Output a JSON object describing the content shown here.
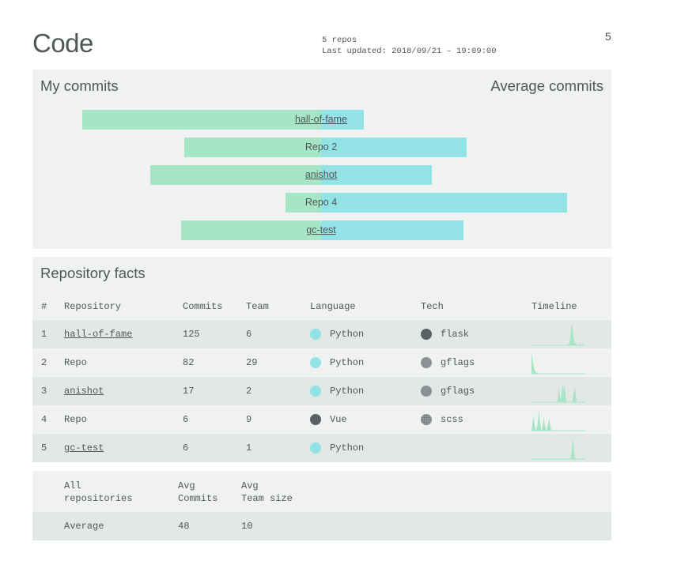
{
  "header": {
    "title": "Code",
    "repo_count": "5 repos",
    "last_updated": "Last updated: 2018/09/21 – 19:09:00",
    "page_number": "5"
  },
  "commits": {
    "my_commits_label": "My commits",
    "average_commits_label": "Average commits",
    "bars": [
      {
        "label": "hall-of-fame",
        "link": true,
        "my_extent": 302,
        "avg_extent": 54
      },
      {
        "label": "Repo 2",
        "link": false,
        "my_extent": 173,
        "avg_extent": 184
      },
      {
        "label": "anishot",
        "link": true,
        "my_extent": 216,
        "avg_extent": 140
      },
      {
        "label": "Repo 4",
        "link": false,
        "my_extent": 45,
        "avg_extent": 311
      },
      {
        "label": "gc-test",
        "link": true,
        "my_extent": 177,
        "avg_extent": 180
      }
    ],
    "colors": {
      "my": "#a6e6c6",
      "average": "#93e2e6"
    }
  },
  "facts": {
    "heading": "Repository facts",
    "columns": [
      "#",
      "Repository",
      "Commits",
      "Team",
      "Language",
      "Tech",
      "Timeline"
    ],
    "rows": [
      {
        "num": "1",
        "repo": "hall-of-fame",
        "link": true,
        "commits": "125",
        "team": "6",
        "language": "Python",
        "lang_color": "#93e2e6",
        "tech": "flask",
        "tech_color": "#5a6163",
        "timeline": [
          0,
          0,
          0,
          0,
          0,
          0,
          0,
          0,
          0,
          0,
          0,
          0,
          0,
          0,
          0,
          0,
          0,
          0,
          0,
          0,
          0,
          0,
          0,
          0,
          0,
          0,
          0,
          0,
          0,
          0,
          0,
          0,
          0,
          0,
          0,
          0,
          0,
          0,
          0,
          0,
          0.1,
          0.3,
          0.8,
          1,
          0.6,
          0.2,
          0.1,
          0.05,
          0,
          0,
          0,
          0.1,
          0.05,
          0,
          0.1,
          0,
          0,
          0
        ]
      },
      {
        "num": "2",
        "repo": "Repo",
        "link": false,
        "commits": "82",
        "team": "29",
        "language": "Python",
        "lang_color": "#93e2e6",
        "tech": "gflags",
        "tech_color": "#8b9294",
        "timeline": [
          0.9,
          0.7,
          0.4,
          0.2,
          0.1,
          0.05,
          0.05,
          0,
          0,
          0,
          0,
          0,
          0,
          0,
          0,
          0,
          0,
          0,
          0,
          0,
          0,
          0,
          0,
          0,
          0,
          0,
          0,
          0,
          0,
          0,
          0,
          0,
          0,
          0,
          0,
          0,
          0,
          0,
          0,
          0,
          0,
          0,
          0,
          0,
          0,
          0,
          0,
          0,
          0,
          0,
          0,
          0,
          0,
          0,
          0,
          0,
          0,
          0
        ]
      },
      {
        "num": "3",
        "repo": "anishot",
        "link": true,
        "commits": "17",
        "team": "2",
        "language": "Python",
        "lang_color": "#93e2e6",
        "tech": "gflags",
        "tech_color": "#8b9294",
        "timeline": [
          0,
          0,
          0,
          0,
          0,
          0,
          0,
          0,
          0,
          0,
          0,
          0,
          0,
          0,
          0,
          0,
          0,
          0,
          0,
          0,
          0,
          0,
          0,
          0,
          0,
          0,
          0,
          0,
          0.2,
          0.6,
          0.3,
          0.1,
          0.4,
          0.8,
          0.5,
          0.9,
          0.3,
          0.1,
          0,
          0,
          0,
          0,
          0,
          0,
          0.2,
          0.5,
          0.7,
          0.3,
          0,
          0,
          0,
          0,
          0,
          0,
          0,
          0,
          0,
          0
        ]
      },
      {
        "num": "4",
        "repo": "Repo",
        "link": false,
        "commits": "6",
        "team": "9",
        "language": "Vue",
        "lang_color": "#5a6163",
        "tech": "scss",
        "tech_color": "#9aa0a2",
        "timeline": [
          0,
          0.3,
          0.7,
          0.4,
          0.1,
          0,
          0.2,
          0.5,
          0.9,
          0.4,
          0.1,
          0,
          0.3,
          0.6,
          0.3,
          0.1,
          0,
          0.2,
          0.4,
          0.5,
          0.2,
          0,
          0,
          0,
          0,
          0,
          0,
          0,
          0,
          0,
          0,
          0,
          0,
          0,
          0,
          0,
          0,
          0,
          0,
          0,
          0,
          0,
          0,
          0,
          0,
          0,
          0,
          0,
          0,
          0,
          0,
          0,
          0,
          0,
          0,
          0,
          0,
          0
        ]
      },
      {
        "num": "5",
        "repo": "gc-test",
        "link": true,
        "commits": "6",
        "team": "1",
        "language": "Python",
        "lang_color": "#93e2e6",
        "tech": "",
        "tech_color": "",
        "timeline": [
          0.02,
          0.02,
          0.02,
          0.02,
          0.02,
          0.02,
          0.02,
          0.02,
          0.02,
          0.02,
          0.02,
          0.02,
          0.02,
          0.02,
          0.02,
          0.02,
          0.02,
          0.02,
          0.02,
          0.02,
          0.02,
          0.02,
          0.02,
          0.02,
          0.02,
          0.02,
          0.02,
          0.02,
          0.02,
          0.02,
          0.02,
          0.02,
          0.02,
          0.02,
          0.02,
          0.02,
          0.02,
          0.02,
          0.02,
          0.02,
          0.02,
          0.02,
          0.1,
          0.5,
          1,
          0.3,
          0.05,
          0.02,
          0.02,
          0.02,
          0.02,
          0.02,
          0.02,
          0.02,
          0.02,
          0.02,
          0.02,
          0.02
        ]
      }
    ]
  },
  "summary": {
    "header": {
      "col1": "All\nrepositories",
      "col2": "Avg\nCommits",
      "col3": "Avg\nTeam size"
    },
    "row": {
      "label": "Average",
      "avg_commits": "48",
      "avg_team": "10"
    }
  }
}
